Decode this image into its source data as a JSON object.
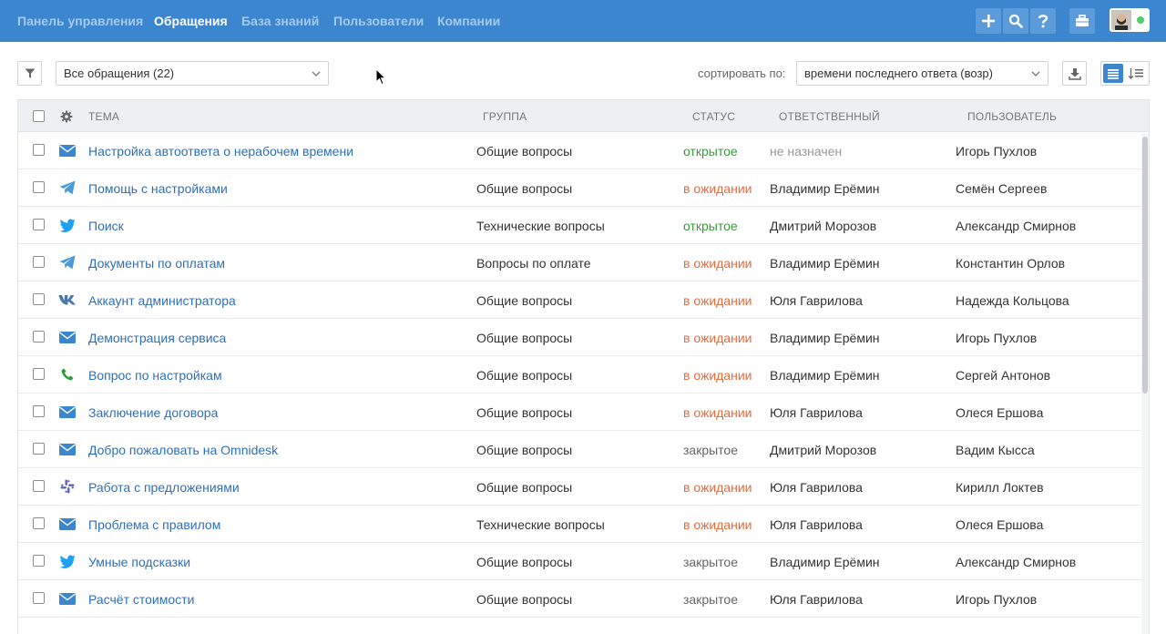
{
  "nav": {
    "dashboard": "Панель управления",
    "tickets": "Обращения",
    "knowledge_base": "База знаний",
    "users": "Пользователи",
    "companies": "Компании"
  },
  "toolbar": {
    "view_select": "Все обращения (22)",
    "sort_label": "сортировать по:",
    "sort_select": "времени последнего ответа (возр)"
  },
  "table": {
    "headers": {
      "subject": "Тема",
      "group": "Группа",
      "status": "Статус",
      "assignee": "Ответственный",
      "user": "Пользователь"
    },
    "rows": [
      {
        "channel": "email-icon",
        "subject": "Настройка автоответа о нерабочем времени",
        "group": "Общие вопросы",
        "status": "открытое",
        "status_type": "open",
        "assignee": "не назначен",
        "assignee_unassigned": true,
        "user": "Игорь Пухлов"
      },
      {
        "channel": "telegram-icon",
        "subject": "Помощь с настройками",
        "group": "Общие вопросы",
        "status": "в ожидании",
        "status_type": "wait",
        "assignee": "Владимир Ерёмин",
        "user": "Семён Сергеев"
      },
      {
        "channel": "twitter-icon",
        "subject": "Поиск",
        "group": "Технические вопросы",
        "status": "открытое",
        "status_type": "open",
        "assignee": "Дмитрий Морозов",
        "user": "Александр Смирнов"
      },
      {
        "channel": "telegram-icon",
        "subject": "Документы по оплатам",
        "group": "Вопросы по оплате",
        "status": "в ожидании",
        "status_type": "wait",
        "assignee": "Владимир Ерёмин",
        "user": "Константин Орлов"
      },
      {
        "channel": "vk-icon",
        "subject": "Аккаунт администратора",
        "group": "Общие вопросы",
        "status": "в ожидании",
        "status_type": "wait",
        "assignee": "Юля Гаврилова",
        "user": "Надежда Кольцова"
      },
      {
        "channel": "email-icon",
        "subject": "Демонстрация сервиса",
        "group": "Общие вопросы",
        "status": "в ожидании",
        "status_type": "wait",
        "assignee": "Владимир Ерёмин",
        "user": "Игорь Пухлов"
      },
      {
        "channel": "phone-icon",
        "subject": "Вопрос по настройкам",
        "group": "Общие вопросы",
        "status": "в ожидании",
        "status_type": "wait",
        "assignee": "Владимир Ерёмин",
        "user": "Сергей Антонов"
      },
      {
        "channel": "email-icon",
        "subject": "Заключение договора",
        "group": "Общие вопросы",
        "status": "в ожидании",
        "status_type": "wait",
        "assignee": "Юля Гаврилова",
        "user": "Олеся Ершова"
      },
      {
        "channel": "email-icon",
        "subject": "Добро пожаловать на Omnidesk",
        "group": "Общие вопросы",
        "status": "закрытое",
        "status_type": "closed",
        "assignee": "Дмитрий Морозов",
        "user": "Вадим Кысса"
      },
      {
        "channel": "slack-icon",
        "subject": "Работа с предложениями",
        "group": "Общие вопросы",
        "status": "в ожидании",
        "status_type": "wait",
        "assignee": "Юля Гаврилова",
        "user": "Кирилл Локтев"
      },
      {
        "channel": "email-icon",
        "subject": "Проблема с правилом",
        "group": "Технические вопросы",
        "status": "в ожидании",
        "status_type": "wait",
        "assignee": "Юля Гаврилова",
        "user": "Олеся Ершова"
      },
      {
        "channel": "twitter-icon",
        "subject": "Умные подсказки",
        "group": "Общие вопросы",
        "status": "закрытое",
        "status_type": "closed",
        "assignee": "Владимир Ерёмин",
        "user": "Александр Смирнов"
      },
      {
        "channel": "email-icon",
        "subject": "Расчёт стоимости",
        "group": "Общие вопросы",
        "status": "закрытое",
        "status_type": "closed",
        "assignee": "Юля Гаврилова",
        "user": "Игорь Пухлов"
      }
    ]
  },
  "colors": {
    "brand": "#3b86cf",
    "link": "#2f6fb9",
    "status_open": "#3a9a3a",
    "status_wait": "#ea6a3a",
    "status_closed": "#666666",
    "online": "#4cd26a"
  }
}
